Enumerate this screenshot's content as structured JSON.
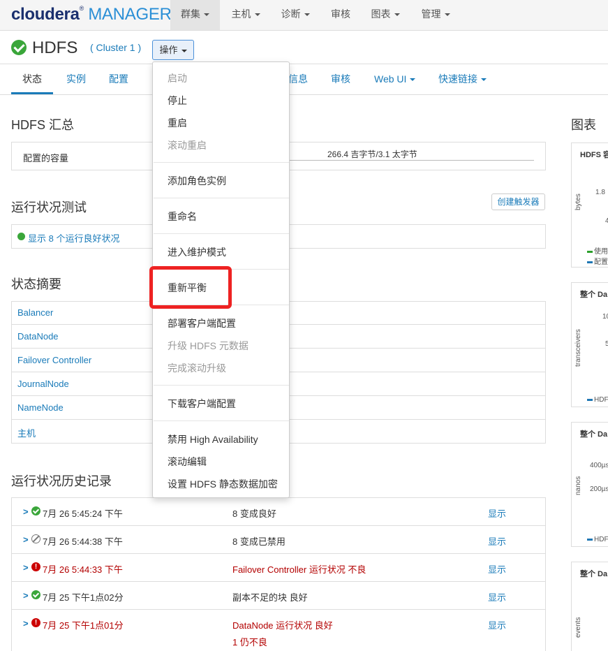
{
  "topnav": {
    "logo_brand": "cloudera",
    "logo_reg": "®",
    "logo_product": "MANAGER",
    "items": [
      {
        "label": "群集",
        "active": true
      },
      {
        "label": "主机",
        "active": false
      },
      {
        "label": "诊断",
        "active": false
      },
      {
        "label": "审核",
        "active": false
      },
      {
        "label": "图表",
        "active": false
      },
      {
        "label": "管理",
        "active": false
      }
    ]
  },
  "service": {
    "name": "HDFS",
    "cluster_link": "( Cluster 1 )",
    "actions_label": "操作"
  },
  "subtabs": [
    {
      "label": "状态",
      "active": true
    },
    {
      "label": "实例"
    },
    {
      "label": "配置"
    },
    {
      "label": "信息"
    },
    {
      "label": "审核"
    },
    {
      "label": "Web UI"
    },
    {
      "label": "快速链接"
    }
  ],
  "summary": {
    "title": "HDFS 汇总",
    "capacity_label": "配置的容量",
    "capacity_value": "266.4 吉字节/3.1 太字节"
  },
  "health_tests": {
    "title": "运行状况测试",
    "create_trigger": "创建触发器",
    "show_good": "显示 8 个运行良好状况"
  },
  "status_summary": {
    "title": "状态摘要",
    "rows": [
      "Balancer",
      "DataNode",
      "Failover Controller",
      "JournalNode",
      "NameNode",
      "主机"
    ]
  },
  "history": {
    "title": "运行状况历史记录",
    "rows": [
      {
        "status": "ok",
        "time": "7月 26 5:45:24 下午",
        "desc": "8 变成良好",
        "show": "显示",
        "red": false
      },
      {
        "status": "disabled",
        "time": "7月 26 5:44:38 下午",
        "desc": "8 变成已禁用",
        "show": "显示",
        "red": false
      },
      {
        "status": "bad",
        "time": "7月 26 5:44:33 下午",
        "desc": "Failover Controller 运行状况 不良",
        "show": "显示",
        "red": true
      },
      {
        "status": "ok",
        "time": "7月 25 下午1点02分",
        "desc": "副本不足的块 良好",
        "show": "显示",
        "red": false
      },
      {
        "status": "bad",
        "time": "7月 25 下午1点01分",
        "desc": "DataNode 运行状况 良好",
        "desc2": "1 仍不良",
        "show": "显示",
        "red": true
      }
    ]
  },
  "charts": {
    "title": "图表",
    "cards": [
      {
        "title": "HDFS 容",
        "ylabel": "bytes",
        "ticks": [
          "1.8",
          "4"
        ],
        "legend": [
          {
            "label": "使用",
            "color": "#2ca02c"
          },
          {
            "label": "配置",
            "color": "#1f77b4"
          }
        ]
      },
      {
        "title": "整个 Da",
        "ylabel": "transceivers",
        "ticks": [
          "10",
          "5"
        ],
        "legend": [
          {
            "label": "HDF",
            "color": "#1f77b4"
          }
        ]
      },
      {
        "title": "整个 Da",
        "ylabel": "nanos",
        "ticks": [
          "400µs",
          "200µs"
        ],
        "legend": [
          {
            "label": "HDF",
            "color": "#1f77b4"
          }
        ]
      },
      {
        "title": "整个 Da",
        "ylabel": "events",
        "ticks": [],
        "legend": []
      }
    ]
  },
  "actions_menu": {
    "items": [
      {
        "label": "启动",
        "disabled": true
      },
      {
        "label": "停止",
        "disabled": false
      },
      {
        "label": "重启",
        "disabled": false
      },
      {
        "label": "滚动重启",
        "disabled": true
      },
      {
        "label": "添加角色实例",
        "disabled": false
      },
      {
        "label": "重命名",
        "disabled": false
      },
      {
        "label": "进入维护模式",
        "disabled": false
      },
      {
        "label": "重新平衡",
        "disabled": false
      },
      {
        "label": "部署客户端配置",
        "disabled": false
      },
      {
        "label": "升级 HDFS 元数据",
        "disabled": true
      },
      {
        "label": "完成滚动升级",
        "disabled": true
      },
      {
        "label": "下载客户端配置",
        "disabled": false
      },
      {
        "label": "禁用 High Availability",
        "disabled": false
      },
      {
        "label": "滚动编辑",
        "disabled": false
      },
      {
        "label": "设置 HDFS 静态数据加密",
        "disabled": false
      }
    ]
  }
}
